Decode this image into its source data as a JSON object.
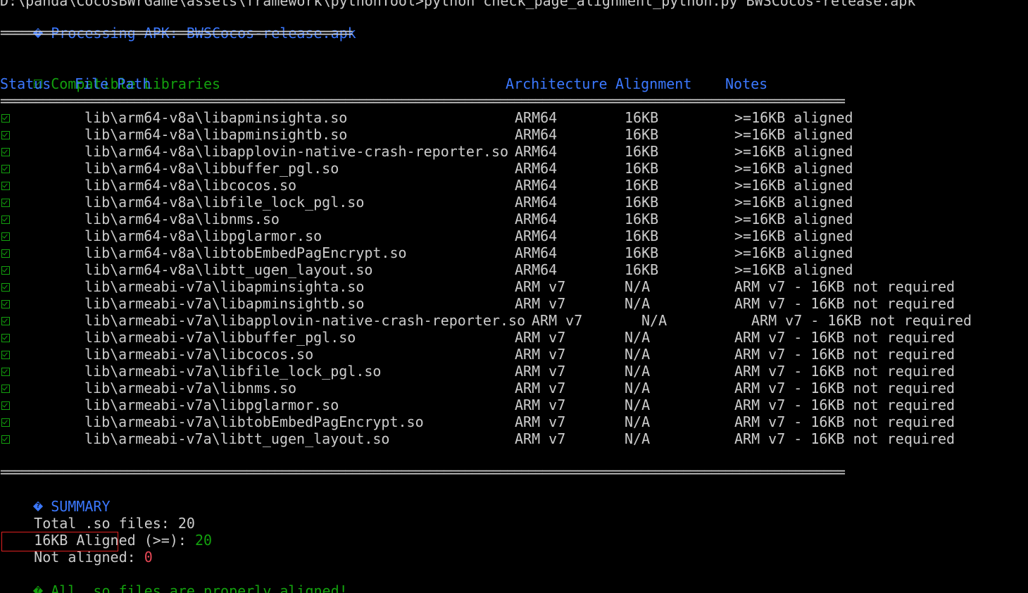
{
  "terminal": {
    "command_line": "D:\\panda\\CocosBWrGame\\assets\\framework\\pythonTool>python check_page_alignment_python.py BWSCocos-release.apk",
    "processing": "Processing APK: BWSCocos-release.apk",
    "separator_short": "==================================================",
    "section_title": "Compatible Libraries",
    "headers": {
      "status": "Status",
      "file_path": "File Path",
      "architecture": "Architecture",
      "alignment": "Alignment",
      "notes": "Notes"
    },
    "separator_long": "========================================================================================================================",
    "libraries": [
      {
        "path": "lib\\arm64-v8a\\libapminsighta.so",
        "arch": "ARM64",
        "align": "16KB",
        "notes": ">=16KB aligned"
      },
      {
        "path": "lib\\arm64-v8a\\libapminsightb.so",
        "arch": "ARM64",
        "align": "16KB",
        "notes": ">=16KB aligned"
      },
      {
        "path": "lib\\arm64-v8a\\libapplovin-native-crash-reporter.so",
        "arch": "ARM64",
        "align": "16KB",
        "notes": ">=16KB aligned"
      },
      {
        "path": "lib\\arm64-v8a\\libbuffer_pgl.so",
        "arch": "ARM64",
        "align": "16KB",
        "notes": ">=16KB aligned"
      },
      {
        "path": "lib\\arm64-v8a\\libcocos.so",
        "arch": "ARM64",
        "align": "16KB",
        "notes": ">=16KB aligned"
      },
      {
        "path": "lib\\arm64-v8a\\libfile_lock_pgl.so",
        "arch": "ARM64",
        "align": "16KB",
        "notes": ">=16KB aligned"
      },
      {
        "path": "lib\\arm64-v8a\\libnms.so",
        "arch": "ARM64",
        "align": "16KB",
        "notes": ">=16KB aligned"
      },
      {
        "path": "lib\\arm64-v8a\\libpglarmor.so",
        "arch": "ARM64",
        "align": "16KB",
        "notes": ">=16KB aligned"
      },
      {
        "path": "lib\\arm64-v8a\\libtobEmbedPagEncrypt.so",
        "arch": "ARM64",
        "align": "16KB",
        "notes": ">=16KB aligned"
      },
      {
        "path": "lib\\arm64-v8a\\libtt_ugen_layout.so",
        "arch": "ARM64",
        "align": "16KB",
        "notes": ">=16KB aligned"
      },
      {
        "path": "lib\\armeabi-v7a\\libapminsighta.so",
        "arch": "ARM v7",
        "align": "N/A",
        "notes": "ARM v7 - 16KB not required"
      },
      {
        "path": "lib\\armeabi-v7a\\libapminsightb.so",
        "arch": "ARM v7",
        "align": "N/A",
        "notes": "ARM v7 - 16KB not required"
      },
      {
        "path": "lib\\armeabi-v7a\\libapplovin-native-crash-reporter.so",
        "arch": "ARM v7",
        "align": "N/A",
        "notes": "ARM v7 - 16KB not required"
      },
      {
        "path": "lib\\armeabi-v7a\\libbuffer_pgl.so",
        "arch": "ARM v7",
        "align": "N/A",
        "notes": "ARM v7 - 16KB not required"
      },
      {
        "path": "lib\\armeabi-v7a\\libcocos.so",
        "arch": "ARM v7",
        "align": "N/A",
        "notes": "ARM v7 - 16KB not required"
      },
      {
        "path": "lib\\armeabi-v7a\\libfile_lock_pgl.so",
        "arch": "ARM v7",
        "align": "N/A",
        "notes": "ARM v7 - 16KB not required"
      },
      {
        "path": "lib\\armeabi-v7a\\libnms.so",
        "arch": "ARM v7",
        "align": "N/A",
        "notes": "ARM v7 - 16KB not required"
      },
      {
        "path": "lib\\armeabi-v7a\\libpglarmor.so",
        "arch": "ARM v7",
        "align": "N/A",
        "notes": "ARM v7 - 16KB not required"
      },
      {
        "path": "lib\\armeabi-v7a\\libtobEmbedPagEncrypt.so",
        "arch": "ARM v7",
        "align": "N/A",
        "notes": "ARM v7 - 16KB not required"
      },
      {
        "path": "lib\\armeabi-v7a\\libtt_ugen_layout.so",
        "arch": "ARM v7",
        "align": "N/A",
        "notes": "ARM v7 - 16KB not required"
      }
    ],
    "summary": {
      "title": "SUMMARY",
      "total_label": "Total .so files: ",
      "total_value": "20",
      "aligned_label": "16KB Aligned (>=): ",
      "aligned_value": "20",
      "not_aligned_label": "Not aligned: ",
      "not_aligned_value": "0",
      "final_message": "All .so files are properly aligned!"
    },
    "colors": {
      "background": "#000000",
      "text": "#cccccc",
      "blue": "#3b78ff",
      "green": "#13a10e",
      "red": "#e74856",
      "highlight_box": "#e02020"
    },
    "icons": {
      "status_ok": "check-box-icon",
      "info": "diamond-icon"
    }
  }
}
